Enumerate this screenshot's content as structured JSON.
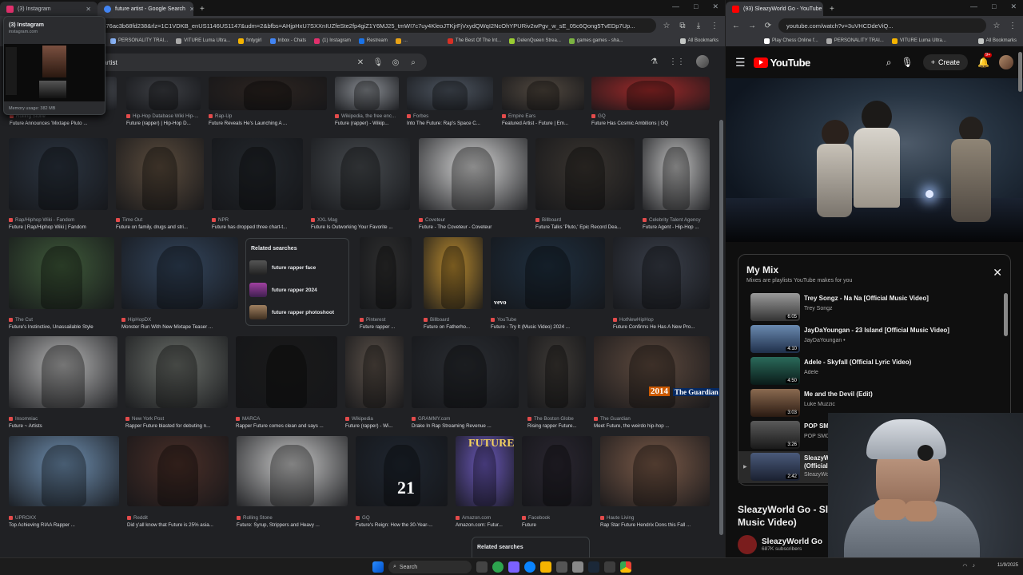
{
  "left_window": {
    "tabs": [
      {
        "title": "(3) Instagram",
        "favicon_color": "#e1306c",
        "active": false
      },
      {
        "title": "future artist - Google Search",
        "favicon_color": "#4285f4",
        "active": true
      }
    ],
    "url": "ch?sca_esv=a4676ac3b68fd238&rlz=1C1VDKB_enUS1146US1147&udm=2&bfbs=AHjpHxU7SXXnIUZfeSte2fp4giZ1Y6MJ25_tmWI7c7uy4KleoJTKjrFjVxydQWqI2NcOhYPURiv2wPgv_w_sE_05c6Qong5TvEDp7Up...",
    "bookmarks": [
      "PERSONALITY TRAI...",
      "VITURE Luma Ultra...",
      "fmtygirl",
      "Inbox - Chats",
      "(1) Instagram",
      "Restream",
      "...",
      "The Best Of The Int...",
      "DelenQueen Strea...",
      "games games - sha..."
    ],
    "all_bookmarks": "All Bookmarks",
    "popup": {
      "title": "(3) Instagram",
      "url": "instagram.com",
      "memory": "Memory usage: 382 MB"
    },
    "search_query": "re artist",
    "related": {
      "heading": "Related searches",
      "items": [
        "future rapper face",
        "future rapper 2024",
        "future rapper photoshoot"
      ],
      "heading2": "Related searches"
    },
    "results": [
      {
        "src": "Rolling Stone",
        "title": "Future Announces 'Mixtape Pluto ..."
      },
      {
        "src": "Hip-Hop Database Wiki Hip-...",
        "title": "Future (rapper) | Hip-Hop D..."
      },
      {
        "src": "Rap-Up",
        "title": "Future Reveals He's Launching A ..."
      },
      {
        "src": "Wikipedia, the free enc...",
        "title": "Future (rapper) - Wikip..."
      },
      {
        "src": "Forbes",
        "title": "Into The Future: Rap's Space C..."
      },
      {
        "src": "Empire Ears",
        "title": "Featured Artist - Future | Em..."
      },
      {
        "src": "GQ",
        "title": "Future Has Cosmic Ambitions | GQ"
      },
      {
        "src": "Rap/Hiphop Wiki - Fandom",
        "title": "Future | Rap/Hiphop Wiki | Fandom"
      },
      {
        "src": "Time Out",
        "title": "Future on family, drugs and stri..."
      },
      {
        "src": "NPR",
        "title": "Future has dropped three chart-t..."
      },
      {
        "src": "XXL Mag",
        "title": "Future Is Outworking Your Favorite ..."
      },
      {
        "src": "Coveteur",
        "title": "Future - The Coveteur - Coveteur"
      },
      {
        "src": "Billboard",
        "title": "Future Talks 'Pluto,' Epic Record Dea..."
      },
      {
        "src": "Celebrity Talent Agency",
        "title": "Future Agent - Hip-Hop ..."
      },
      {
        "src": "The Cut",
        "title": "Future's Instinctive, Unassailable Style"
      },
      {
        "src": "HipHopDX",
        "title": "Monster Run With New Mixtape Teaser ..."
      },
      {
        "src": "Pinterest",
        "title": "Future rapper ..."
      },
      {
        "src": "Billboard",
        "title": "Future on Fatherho..."
      },
      {
        "src": "YouTube",
        "title": "Future - Try It (Music Video) 2024 ..."
      },
      {
        "src": "HotNewHipHop",
        "title": "Future Confirms He Has A New Pro..."
      },
      {
        "src": "Insomniac",
        "title": "Future ~ Artists"
      },
      {
        "src": "New York Post",
        "title": "Rapper Future blasted for debuting n..."
      },
      {
        "src": "MARCA",
        "title": "Rapper Future comes clean and says ..."
      },
      {
        "src": "Wikipedia",
        "title": "Future (rapper) - Wi..."
      },
      {
        "src": "GRAMMY.com",
        "title": "Drake In Rap Streaming Revenue ..."
      },
      {
        "src": "The Boston Globe",
        "title": "Rising rapper Future..."
      },
      {
        "src": "The Guardian",
        "title": "Meet Future, the weirdo hip-hop ..."
      },
      {
        "src": "UPROXX",
        "title": "Top Achieving RIAA Rapper ..."
      },
      {
        "src": "Reddit",
        "title": "Did y'all know that Future is 25% asia..."
      },
      {
        "src": "Rolling Stone",
        "title": "Future: Syrup, Strippers and Heavy ..."
      },
      {
        "src": "GQ",
        "title": "Future's Reign: How the 30-Year-..."
      },
      {
        "src": "Amazon.com",
        "title": "Amazon.com: Futur..."
      },
      {
        "src": "Facebook",
        "title": "Future"
      },
      {
        "src": "Haute Living",
        "title": "Rap Star Future Hendrix Dons this Fall ..."
      }
    ],
    "overlay_text": {
      "future": "FUTURE",
      "jersey": "21",
      "guardian_year": "2014",
      "guardian": "The Guardian",
      "vevo": "vevo"
    }
  },
  "right_window": {
    "tabs": [
      {
        "title": "(93) SleazyWorld Go - YouTube",
        "favicon_color": "#ff0000",
        "active": true
      }
    ],
    "url": "youtube.com/watch?v=3uVHCDdeViQ...",
    "bookmarks": [
      "Play Chess Online f...",
      "PERSONALITY TRAI...",
      "VITURE Luma Ultra..."
    ],
    "all_bookmarks": "All Bookmarks",
    "logo": "YouTube",
    "create_label": "Create",
    "notif_count": "9+",
    "mix": {
      "title": "My Mix",
      "subtitle": "Mixes are playlists YouTube makes for you",
      "items": [
        {
          "title": "Trey Songz - Na Na [Official Music Video]",
          "channel": "Trey Songz",
          "duration": "6:05"
        },
        {
          "title": "JayDaYoungan - 23 Island [Official Music Video]",
          "channel": "JayDaYoungan •",
          "duration": "4:10"
        },
        {
          "title": "Adele - Skyfall (Official Lyric Video)",
          "channel": "Adele",
          "duration": "4:50"
        },
        {
          "title": "Me and the Devil (Edit)",
          "channel": "Luke Muzzic",
          "duration": "3:03"
        },
        {
          "title": "POP SMOKE - W",
          "channel": "POP SMOKE",
          "duration": "3:26"
        },
        {
          "title": "SleazyWorld Go",
          "subtitle2": "(Official Music V",
          "channel": "SleazyWorld Go",
          "duration": "2:42"
        }
      ]
    },
    "video_title": "SleazyWorld Go - Slea Music Video)",
    "channel": {
      "name": "SleazyWorld Go",
      "subs": "687K subscribers"
    }
  },
  "taskbar": {
    "search": "Search",
    "clock": "11/9/2025"
  },
  "colors": {
    "youtube_red": "#ff0000",
    "google_bg": "#202124",
    "yt_bg": "#0f0f0f"
  }
}
